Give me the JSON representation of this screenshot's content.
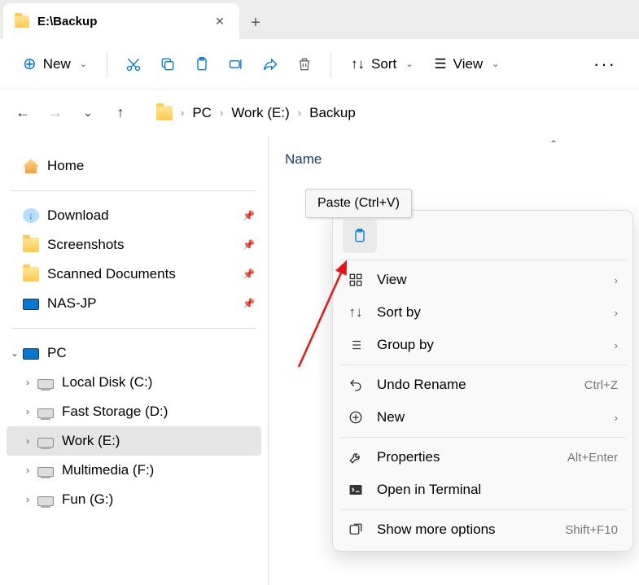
{
  "tab": {
    "title": "E:\\Backup"
  },
  "toolbar": {
    "new": "New",
    "sort": "Sort",
    "view": "View"
  },
  "breadcrumb": {
    "pc": "PC",
    "drive": "Work (E:)",
    "folder": "Backup"
  },
  "sidebar": {
    "home": "Home",
    "quick": [
      {
        "label": "Download"
      },
      {
        "label": "Screenshots"
      },
      {
        "label": "Scanned Documents"
      },
      {
        "label": "NAS-JP"
      }
    ],
    "pc": "PC",
    "drives": [
      {
        "label": "Local Disk (C:)"
      },
      {
        "label": "Fast Storage (D:)"
      },
      {
        "label": "Work (E:)"
      },
      {
        "label": "Multimedia (F:)"
      },
      {
        "label": "Fun (G:)"
      }
    ]
  },
  "content": {
    "column_name": "Name"
  },
  "tooltip": {
    "text": "Paste (Ctrl+V)"
  },
  "context_menu": {
    "view": "View",
    "sort_by": "Sort by",
    "group_by": "Group by",
    "undo": "Undo Rename",
    "undo_sc": "Ctrl+Z",
    "new": "New",
    "properties": "Properties",
    "properties_sc": "Alt+Enter",
    "terminal": "Open in Terminal",
    "more": "Show more options",
    "more_sc": "Shift+F10"
  }
}
